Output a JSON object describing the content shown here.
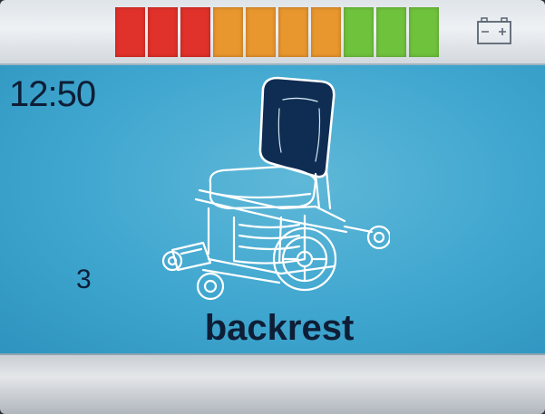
{
  "status_bar": {
    "battery_level": {
      "segments": 10,
      "lit_segments": 10,
      "segment_colors": [
        "#e0312a",
        "#e0312a",
        "#e0312a",
        "#e8962e",
        "#e8962e",
        "#e8962e",
        "#e8962e",
        "#6fc23c",
        "#6fc23c",
        "#6fc23c"
      ]
    },
    "battery_icon": "battery-icon"
  },
  "main": {
    "time": "12:50",
    "mode_number": "3",
    "function_label": "backrest",
    "illustration": "wheelchair-backrest-icon",
    "highlight_color": "#0f2c52"
  }
}
